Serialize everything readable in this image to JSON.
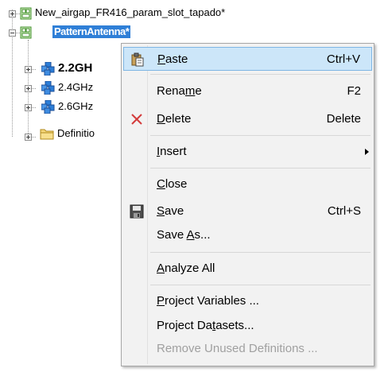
{
  "tree": {
    "project_file": "New_airgap_FR416_param_slot_tapado*",
    "selected_project": "PatternAntenna*",
    "children": [
      {
        "label": "2.2GH",
        "bold": true
      },
      {
        "label": "2.4GHz"
      },
      {
        "label": "2.6GHz"
      },
      {
        "label": "Definitio"
      }
    ]
  },
  "menu": {
    "items": [
      {
        "pre": "",
        "acc": "P",
        "post": "aste",
        "shortcut": "Ctrl+V",
        "icon": "paste-icon"
      },
      {
        "pre": "Rena",
        "acc": "m",
        "post": "e",
        "shortcut": "F2"
      },
      {
        "pre": "",
        "acc": "D",
        "post": "elete",
        "shortcut": "Delete",
        "icon": "delete-x-icon"
      },
      {
        "pre": "",
        "acc": "I",
        "post": "nsert",
        "shortcut": ""
      },
      {
        "pre": "",
        "acc": "C",
        "post": "lose",
        "shortcut": ""
      },
      {
        "pre": "",
        "acc": "S",
        "post": "ave",
        "shortcut": "Ctrl+S",
        "icon": "floppy-disk-icon"
      },
      {
        "pre": "Save ",
        "acc": "A",
        "post": "s...",
        "shortcut": ""
      },
      {
        "pre": "",
        "acc": "A",
        "post": "nalyze All",
        "shortcut": ""
      },
      {
        "pre": "",
        "acc": "P",
        "post": "roject Variables ...",
        "shortcut": ""
      },
      {
        "pre": "Project Da",
        "acc": "t",
        "post": "asets...",
        "shortcut": ""
      },
      {
        "text": "Remove Unused Definitions ...",
        "disabled": true
      }
    ]
  },
  "colors": {
    "selection": "#2f7fd7",
    "menu_highlight": "#cce6f9",
    "menu_background": "#f2f2f2"
  }
}
